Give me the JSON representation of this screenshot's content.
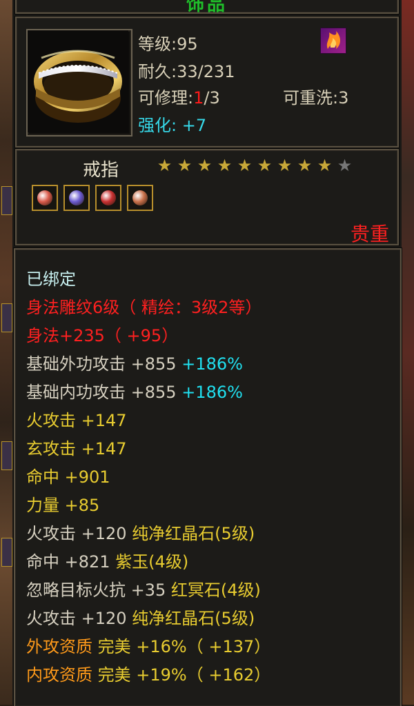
{
  "panel": {
    "title": "饰品"
  },
  "item": {
    "level": "等级:95",
    "durability": "耐久:33/231",
    "repair_label": "可修理:",
    "repair_used": "1",
    "repair_total": "/3",
    "rewash": "可重洗:3",
    "enhance_label": "强化:",
    "enhance_value": "+7",
    "name": "戒指",
    "stars_filled": 9,
    "stars_total": 10,
    "rarity": "贵重"
  },
  "gems": [
    {
      "name": "green-red-gem",
      "color": "#d95a4a"
    },
    {
      "name": "purple-gem",
      "color": "#6a5ad0"
    },
    {
      "name": "red-gem",
      "color": "#c83030"
    },
    {
      "name": "green-red-gem",
      "color": "#c8704a"
    }
  ],
  "attributes": [
    {
      "parts": [
        {
          "t": "已绑定",
          "c": "teal"
        }
      ]
    },
    {
      "parts": [
        {
          "t": "身法雕纹6级（ 精绘：3级2等）",
          "c": "red"
        }
      ]
    },
    {
      "parts": [
        {
          "t": "身法+235（ +95）",
          "c": "red"
        }
      ]
    },
    {
      "parts": [
        {
          "t": "基础外功攻击 +855 ",
          "c": "white"
        },
        {
          "t": "+186%",
          "c": "cyan"
        }
      ]
    },
    {
      "parts": [
        {
          "t": "基础内功攻击 +855 ",
          "c": "white"
        },
        {
          "t": "+186%",
          "c": "cyan"
        }
      ]
    },
    {
      "parts": [
        {
          "t": "火攻击 +147",
          "c": "yellow"
        }
      ]
    },
    {
      "parts": [
        {
          "t": "玄攻击 +147",
          "c": "yellow"
        }
      ]
    },
    {
      "parts": [
        {
          "t": "命中 +901",
          "c": "yellow"
        }
      ]
    },
    {
      "parts": [
        {
          "t": "力量 +85",
          "c": "yellow"
        }
      ]
    },
    {
      "parts": [
        {
          "t": "火攻击 +120 ",
          "c": "white"
        },
        {
          "t": "纯净红晶石(5级)",
          "c": "yellow"
        }
      ]
    },
    {
      "parts": [
        {
          "t": "命中 +821 ",
          "c": "white"
        },
        {
          "t": "紫玉(4级)",
          "c": "yellow"
        }
      ]
    },
    {
      "parts": [
        {
          "t": "忽略目标火抗 +35 ",
          "c": "white"
        },
        {
          "t": "红冥石(4级)",
          "c": "yellow"
        }
      ]
    },
    {
      "parts": [
        {
          "t": "火攻击 +120 ",
          "c": "white"
        },
        {
          "t": "纯净红晶石(5级)",
          "c": "yellow"
        }
      ]
    },
    {
      "parts": [
        {
          "t": "外攻资质  ",
          "c": "orange"
        },
        {
          "t": "完美 +16%（ +137）",
          "c": "yellow"
        }
      ]
    },
    {
      "parts": [
        {
          "t": "内攻资质  ",
          "c": "orange"
        },
        {
          "t": "完美 +19%（ +162）",
          "c": "yellow"
        }
      ]
    }
  ],
  "colors": {
    "red": "#ff2020",
    "cyan": "#20e0f0",
    "yellow": "#e8cc30",
    "orange": "#ff9a1a",
    "white": "#d6d0c0",
    "teal": "#c8f0f0",
    "star_on": "#c8a838",
    "star_off": "#777777"
  },
  "icons": {
    "item_icon": "ring-icon",
    "badge": "flame-emblem-icon"
  }
}
